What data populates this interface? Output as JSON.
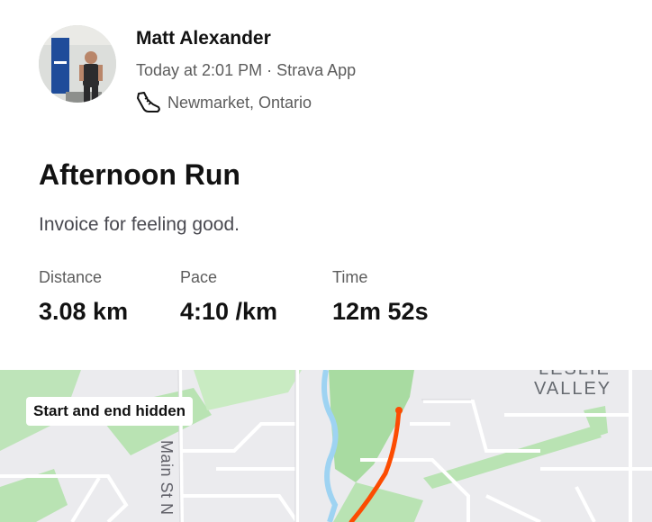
{
  "athlete": {
    "name": "Matt Alexander",
    "timestamp": "Today at 2:01 PM",
    "separator": "·",
    "device": "Strava App",
    "meta_line": "Today at 2:01 PM · Strava App",
    "location": "Newmarket, Ontario",
    "location_icon": "shoe-icon"
  },
  "activity": {
    "title": "Afternoon Run",
    "description": "Invoice for feeling good."
  },
  "stats": [
    {
      "label": "Distance",
      "value": "3.08 km"
    },
    {
      "label": "Pace",
      "value": "4:10 /km"
    },
    {
      "label": "Time",
      "value": "12m 52s"
    }
  ],
  "map": {
    "privacy_badge": "Start and end hidden",
    "street_label": "Main St N",
    "area_label": "VALLEY",
    "area_label_partial": "LESLIE",
    "route_color": "#fc4c02",
    "park_color": "#b9e3b3",
    "water_color": "#9ed3f2",
    "background_color": "#ebebee"
  }
}
